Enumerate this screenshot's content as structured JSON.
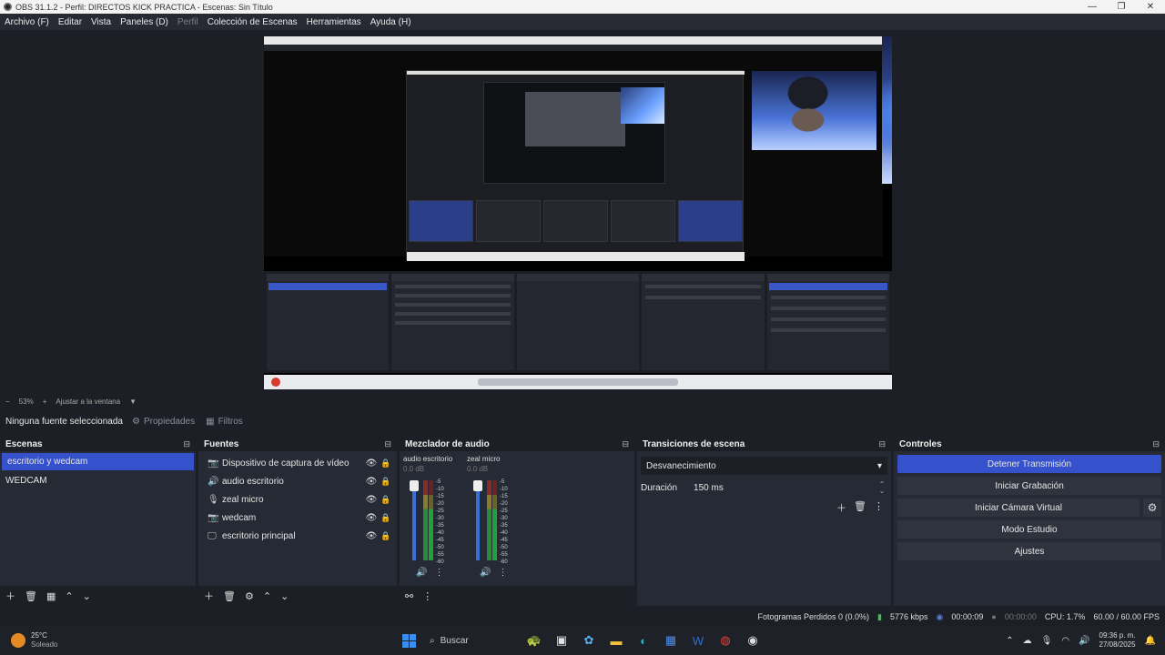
{
  "window": {
    "title": "OBS 31.1.2 - Perfil: DIRECTOS KICK PRACTICA - Escenas: Sin Título",
    "controls": [
      "—",
      "❐",
      "✕"
    ]
  },
  "menu": {
    "archivo": "Archivo (F)",
    "editar": "Editar",
    "vista": "Vista",
    "paneles": "Paneles (D)",
    "perfil": "Perfil",
    "coleccion": "Colección de Escenas",
    "herramientas": "Herramientas",
    "ayuda": "Ayuda (H)"
  },
  "zoom": {
    "minus": "−",
    "level": "53%",
    "plus": "+",
    "mode": "Ajustar a la ventana"
  },
  "source_toolbar": {
    "no_source": "Ninguna fuente seleccionada",
    "properties": "Propiedades",
    "filters": "Filtros"
  },
  "scenes": {
    "title": "Escenas",
    "items": [
      "escritorio y wedcam",
      "WEDCAM"
    ]
  },
  "sources": {
    "title": "Fuentes",
    "items": [
      {
        "icon": "camera-icon",
        "glyph": "📷",
        "name": "Dispositivo de captura de vídeo"
      },
      {
        "icon": "speaker-icon",
        "glyph": "🔊",
        "name": "audio escritorio"
      },
      {
        "icon": "microphone-icon",
        "glyph": "🎙",
        "name": "zeal micro"
      },
      {
        "icon": "camera-icon",
        "glyph": "📷",
        "name": "wedcam"
      },
      {
        "icon": "monitor-icon",
        "glyph": "🖵",
        "name": "escritorio principal"
      }
    ]
  },
  "mixer": {
    "title": "Mezclador de audio",
    "channels": [
      {
        "name": "audio escritorio",
        "db": "0.0 dB",
        "level": 0.78
      },
      {
        "name": "zeal micro",
        "db": "0.0 dB",
        "level": 0.72
      }
    ],
    "ticks": [
      "-5",
      "-10",
      "-15",
      "-20",
      "-25",
      "-30",
      "-35",
      "-40",
      "-45",
      "-50",
      "-55",
      "-60"
    ]
  },
  "transitions": {
    "title": "Transiciones de escena",
    "selected": "Desvanecimiento",
    "duration_label": "Duración",
    "duration_value": "150 ms"
  },
  "controls": {
    "title": "Controles",
    "stop_stream": "Detener Transmisión",
    "start_recording": "Iniciar Grabación",
    "virtual_camera": "Iniciar Cámara Virtual",
    "studio_mode": "Modo Estudio",
    "settings": "Ajustes"
  },
  "status": {
    "dropped_frames": "Fotogramas Perdidos 0 (0.0%)",
    "bitrate": "5776 kbps",
    "stream_time": "00:00:09",
    "rec_time": "00:00:00",
    "cpu": "CPU: 1.7%",
    "fps": "60.00 / 60.00 FPS"
  },
  "taskbar": {
    "temperature": "25°C",
    "weather": "Soleado",
    "search": "Buscar",
    "time": "09:36 p. m.",
    "date": "27/08/2025"
  },
  "colors": {
    "accent": "#3552cc",
    "panel": "#262a34",
    "background": "#1d1f26"
  }
}
